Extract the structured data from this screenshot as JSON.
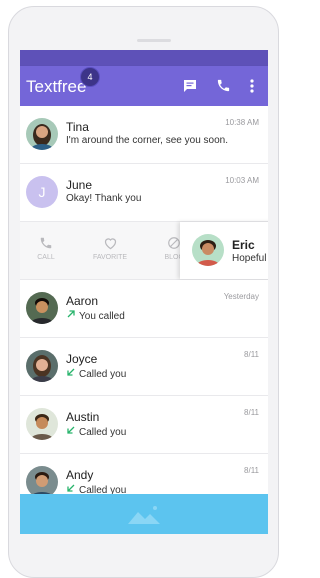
{
  "app": {
    "title": "Textfree",
    "badge_count": "4"
  },
  "colors": {
    "appbar": "#7466d8",
    "statusbar": "#5e51b8",
    "bottombar": "#5cc4ef",
    "call_arrow": "#27b36b"
  },
  "icons": {
    "messages": "message-icon",
    "phone": "phone-icon",
    "more": "more-vert-icon",
    "image": "image-icon"
  },
  "conversations": [
    {
      "name": "Tina",
      "preview": "I'm around the corner, see you soon.",
      "time": "10:38 AM"
    },
    {
      "name": "June",
      "avatar_letter": "J",
      "preview": "Okay! Thank you",
      "time": "10:03 AM"
    }
  ],
  "swipe": {
    "actions": [
      {
        "label": "CALL"
      },
      {
        "label": "FAVORITE"
      },
      {
        "label": "BLOC"
      }
    ],
    "contact": {
      "name": "Eric",
      "preview": "Hopeful"
    }
  },
  "calls": [
    {
      "name": "Aaron",
      "status": "You called",
      "time": "Yesterday",
      "direction": "outgoing"
    },
    {
      "name": "Joyce",
      "status": "Called you",
      "time": "8/11",
      "direction": "incoming"
    },
    {
      "name": "Austin",
      "status": "Called you",
      "time": "8/11",
      "direction": "incoming"
    },
    {
      "name": "Andy",
      "status": "Called you",
      "time": "8/11",
      "direction": "incoming"
    }
  ]
}
